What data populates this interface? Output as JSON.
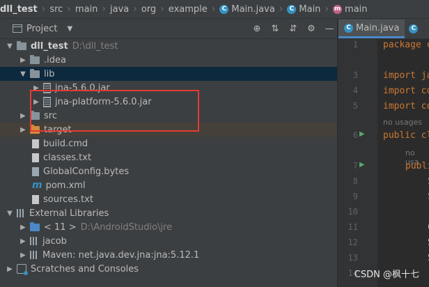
{
  "breadcrumb": {
    "project": "dll_test",
    "src": "src",
    "main": "main",
    "java": "java",
    "org": "org",
    "example": "example",
    "file": "Main.java",
    "class": "Main",
    "method": "main"
  },
  "panel": {
    "title": "Project"
  },
  "tree": {
    "root_name": "dll_test",
    "root_path": "D:\\dll_test",
    "idea": ".idea",
    "lib": "lib",
    "jar1": "jna-5.6.0.jar",
    "jar2": "jna-platform-5.6.0.jar",
    "src": "src",
    "target": "target",
    "build": "build.cmd",
    "classes": "classes.txt",
    "globalconfig": "GlobalConfig.bytes",
    "pom": "pom.xml",
    "sources": "sources.txt",
    "external": "External Libraries",
    "jdk": "< 11 >",
    "jdk_path": "D:\\AndroidStudio\\jre",
    "jacob": "jacob",
    "maven": "Maven: net.java.dev.jna:jna:5.12.1",
    "scratches": "Scratches and Consoles"
  },
  "editor": {
    "tab": "Main.java",
    "lines": {
      "l1_num": "1",
      "l1_code": "package c",
      "l3_num": "3",
      "l3_code": "import ja",
      "l4_num": "4",
      "l4_code": "import co",
      "l5_num": "5",
      "l5_code": "import co",
      "hint1": "no usages",
      "l6_num": "6",
      "l6_code": "public cl",
      "hint2": "no usa",
      "l7_num": "7",
      "l7_code": "publi",
      "l8_num": "8",
      "l9_num": "9",
      "l10_num": "10",
      "l11_num": "11",
      "l12_num": "12",
      "l13_num": "13",
      "l14_num": "14"
    }
  },
  "watermark": "CSDN @枫十七",
  "colors": {
    "panel_bg": "#3c3f41",
    "editor_bg": "#2b2b2b",
    "selected_row": "#0d293e",
    "excluded_row": "#45403a",
    "annotation_box": "#e53935"
  }
}
